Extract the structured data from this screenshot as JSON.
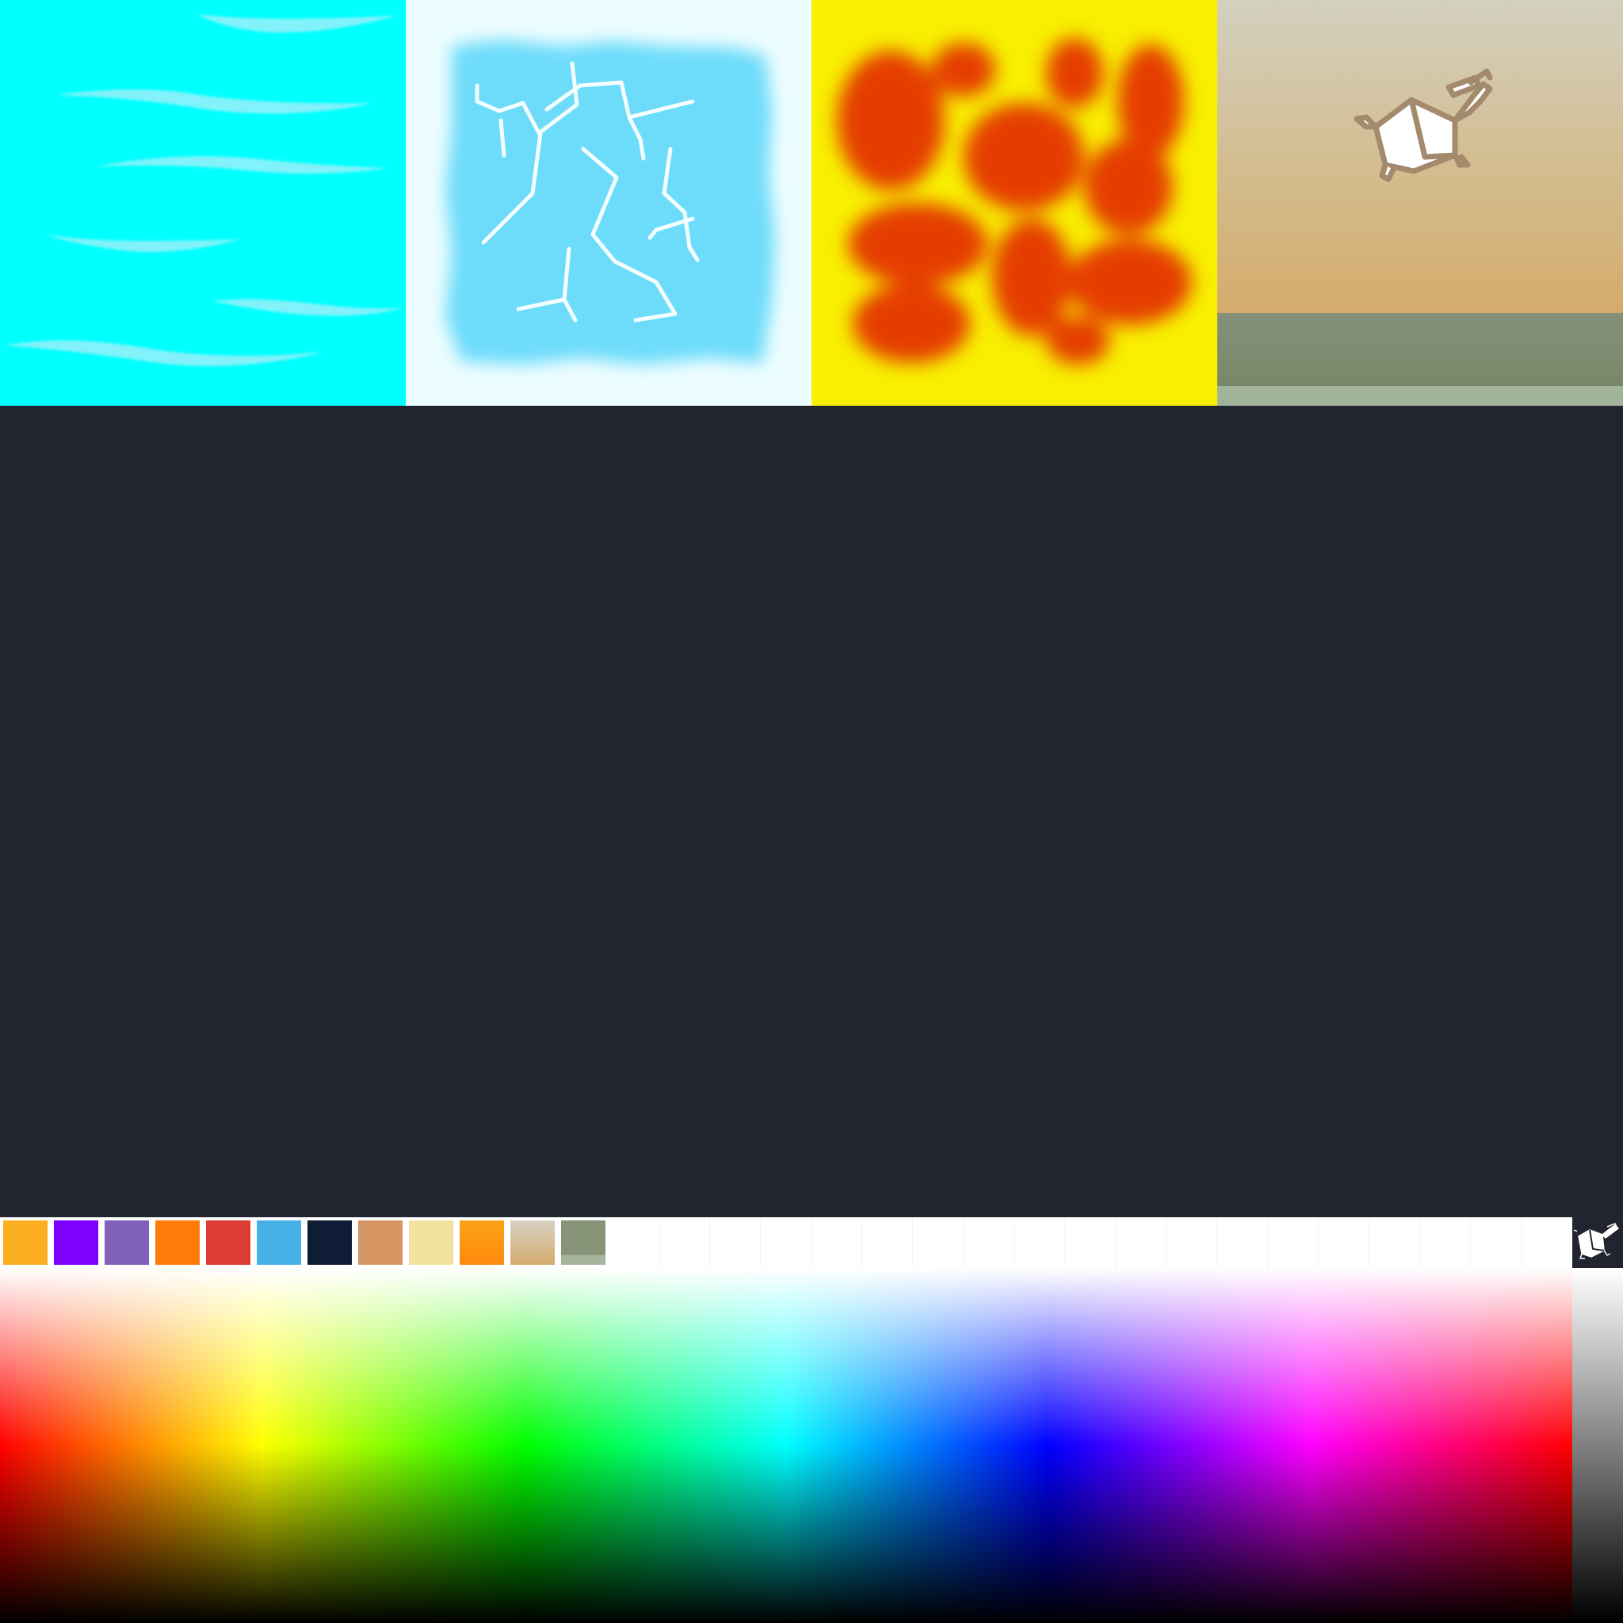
{
  "textures": [
    {
      "name": "water",
      "base_color": "#00ffff",
      "streak_color": "#9af0fa"
    },
    {
      "name": "ice",
      "base_color": "#ecfdff",
      "block_color": "#6ddcfa",
      "crack_color": "#f5feff"
    },
    {
      "name": "lava",
      "base_color": "#f8f000",
      "blob_color": "#e53c00"
    },
    {
      "name": "sand-with-logo",
      "top_color": "#d3d0bf",
      "mid_color": "#d4ab6c",
      "band_color": "#859177",
      "strip_color": "#a1b398",
      "logo_color": "#a48a6d"
    }
  ],
  "workspace": {
    "background": "#22252f"
  },
  "palette": {
    "swatches": [
      {
        "name": "amber",
        "color": "#fbaf1f"
      },
      {
        "name": "violet",
        "color": "#8000ff"
      },
      {
        "name": "lavender",
        "color": "#8060b8"
      },
      {
        "name": "orange",
        "color": "#ff7c09"
      },
      {
        "name": "red",
        "color": "#de3c32"
      },
      {
        "name": "sky-blue",
        "color": "#47b1e6"
      },
      {
        "name": "navy",
        "color": "#0f1d36"
      },
      {
        "name": "tan",
        "color": "#d59663"
      },
      {
        "name": "pale-yellow",
        "color": "#f3e29d"
      },
      {
        "name": "orange-gradient",
        "color": "#fca317",
        "color2": "#ff8a0e"
      },
      {
        "name": "sand-gradient",
        "color": "#d7d2c3",
        "color2": "#d4ab6c"
      },
      {
        "name": "olive-gradient",
        "color": "#879377",
        "color2": "#a6b59c"
      }
    ],
    "empty_slots": 18,
    "logo_icon": "eraser-logo-icon"
  },
  "color_picker": {
    "hue_stops": [
      "#ff0000",
      "#ffff00",
      "#00ff00",
      "#00ffff",
      "#0000ff",
      "#ff00ff",
      "#ff0000"
    ],
    "grayscale": [
      "#ffffff",
      "#808080",
      "#000000"
    ]
  }
}
